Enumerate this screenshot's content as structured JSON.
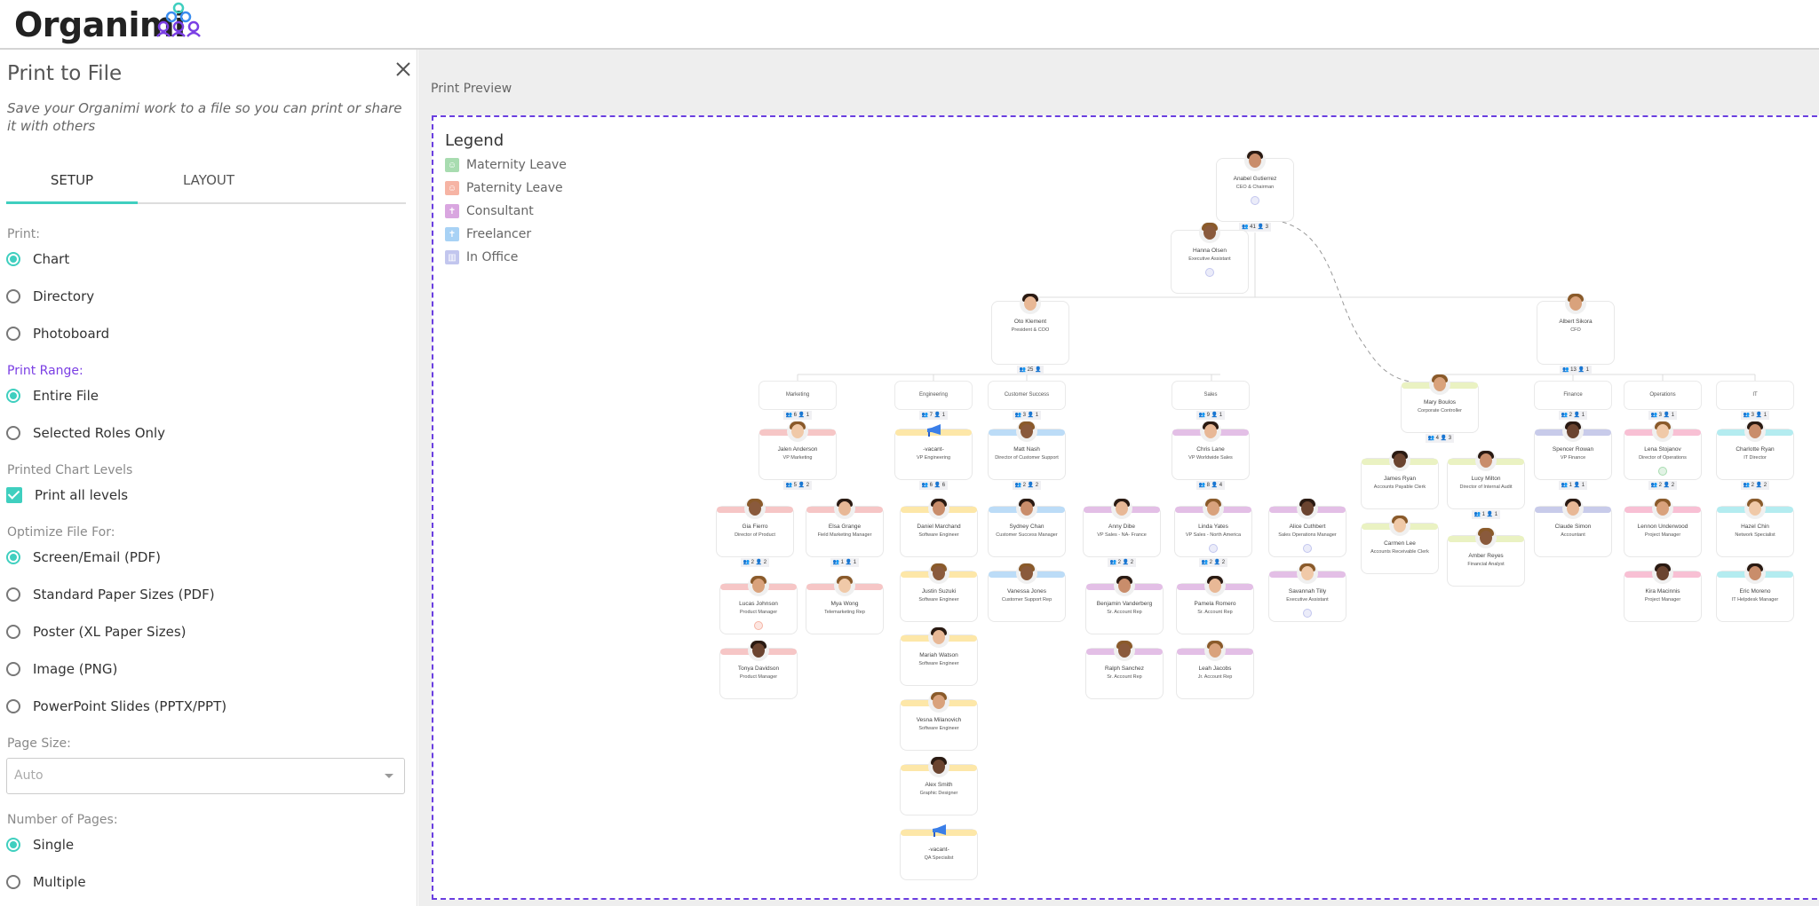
{
  "app": {
    "name": "Organimi"
  },
  "panel": {
    "title": "Print to File",
    "description": "Save your Organimi work to a file so you can print or share it with others",
    "tabs": [
      {
        "label": "SETUP",
        "active": true
      },
      {
        "label": "LAYOUT",
        "active": false
      }
    ],
    "print": {
      "label": "Print:",
      "options": [
        {
          "label": "Chart",
          "selected": true
        },
        {
          "label": "Directory",
          "selected": false
        },
        {
          "label": "Photoboard",
          "selected": false
        }
      ]
    },
    "range": {
      "label": "Print Range:",
      "options": [
        {
          "label": "Entire File",
          "selected": true
        },
        {
          "label": "Selected Roles Only",
          "selected": false
        }
      ]
    },
    "levels": {
      "label": "Printed Chart Levels",
      "checkbox_label": "Print all levels",
      "checked": true
    },
    "optimize": {
      "label": "Optimize File For:",
      "options": [
        {
          "label": "Screen/Email (PDF)",
          "selected": true
        },
        {
          "label": "Standard Paper Sizes (PDF)",
          "selected": false
        },
        {
          "label": "Poster (XL Paper Sizes)",
          "selected": false
        },
        {
          "label": "Image (PNG)",
          "selected": false
        },
        {
          "label": "PowerPoint Slides (PPTX/PPT)",
          "selected": false
        }
      ]
    },
    "page_size": {
      "label": "Page Size:",
      "value": "Auto"
    },
    "pages": {
      "label": "Number of Pages:",
      "options": [
        {
          "label": "Single",
          "selected": true
        },
        {
          "label": "Multiple",
          "selected": false
        }
      ]
    }
  },
  "preview": {
    "label": "Print Preview",
    "legend": {
      "title": "Legend",
      "items": [
        {
          "label": "Maternity Leave",
          "icon": "baby-face-icon",
          "color": "#a8dcb0"
        },
        {
          "label": "Paternity Leave",
          "icon": "baby-face-icon",
          "color": "#f6b4a4"
        },
        {
          "label": "Consultant",
          "icon": "person-icon",
          "color": "#d9a6e0"
        },
        {
          "label": "Freelancer",
          "icon": "person-icon",
          "color": "#a8d2f5"
        },
        {
          "label": "In Office",
          "icon": "building-icon",
          "color": "#c2c6ee"
        }
      ]
    }
  },
  "colors": {
    "accent": "#3fcfbf",
    "purple": "#7b3fe4",
    "marketing": "#f6c6c6",
    "engineering": "#fde7a8",
    "customer_success": "#bcdcf7",
    "sales": "#e3bfe6",
    "controller": "#eaf2c2",
    "finance": "#c8cbea",
    "operations": "#f8c0d4",
    "it": "#b4ecf0"
  },
  "org": {
    "people": [
      {
        "id": "ceo",
        "name": "Anabel Gutierrez",
        "role": "CEO & Chairman",
        "status": "in-office",
        "counts": [
          "41",
          "3"
        ]
      },
      {
        "id": "ea",
        "name": "Hanna Olsen",
        "role": "Executive Assistant",
        "status": "in-office"
      },
      {
        "id": "coo",
        "name": "Oto Klement",
        "role": "President & COO",
        "counts": [
          "25",
          ""
        ]
      },
      {
        "id": "cfo",
        "name": "Albert Sikora",
        "role": "CFO",
        "counts": [
          "13",
          "1"
        ]
      },
      {
        "id": "mkt",
        "dept": "Marketing",
        "counts": [
          "6",
          "1"
        ]
      },
      {
        "id": "eng",
        "dept": "Engineering",
        "counts": [
          "7",
          "1"
        ]
      },
      {
        "id": "cs",
        "dept": "Customer Success",
        "counts": [
          "3",
          "1"
        ]
      },
      {
        "id": "sales",
        "dept": "Sales",
        "counts": [
          "9",
          "1"
        ]
      },
      {
        "id": "fin",
        "dept": "Finance",
        "counts": [
          "2",
          "1"
        ]
      },
      {
        "id": "ops",
        "dept": "Operations",
        "counts": [
          "3",
          "1"
        ]
      },
      {
        "id": "it",
        "dept": "IT",
        "counts": [
          "3",
          "1"
        ]
      },
      {
        "id": "jalen",
        "name": "Jalen Anderson",
        "role": "VP Marketing",
        "team": "marketing",
        "counts": [
          "5",
          "2"
        ]
      },
      {
        "id": "vpeng",
        "name": "-vacant-",
        "role": "VP Engineering",
        "team": "engineering",
        "vacant": true,
        "counts": [
          "6",
          "6"
        ]
      },
      {
        "id": "matt",
        "name": "Matt Nash",
        "role": "Director of Customer Support",
        "team": "customer_success",
        "counts": [
          "2",
          "2"
        ]
      },
      {
        "id": "chris",
        "name": "Chris Lane",
        "role": "VP Worldwide Sales",
        "team": "sales",
        "counts": [
          "8",
          "4"
        ]
      },
      {
        "id": "mary",
        "name": "Mary Boulos",
        "role": "Corporate Controller",
        "team": "controller",
        "counts": [
          "4",
          "3"
        ]
      },
      {
        "id": "spencer",
        "name": "Spencer Rowan",
        "role": "VP Finance",
        "team": "finance",
        "counts": [
          "1",
          "1"
        ]
      },
      {
        "id": "lena",
        "name": "Lena Stojanov",
        "role": "Director of Operations",
        "team": "operations",
        "status": "maternity",
        "counts": [
          "2",
          "2"
        ]
      },
      {
        "id": "charlotte",
        "name": "Charlotte Ryan",
        "role": "IT Director",
        "team": "it",
        "counts": [
          "2",
          "2"
        ]
      },
      {
        "id": "gia",
        "name": "Gia Fierro",
        "role": "Director of Product",
        "team": "marketing",
        "counts": [
          "2",
          "2"
        ]
      },
      {
        "id": "elsa",
        "name": "Elsa Grange",
        "role": "Field Marketing Manager",
        "team": "marketing",
        "counts": [
          "1",
          "1"
        ]
      },
      {
        "id": "lucas",
        "name": "Lucas Johnson",
        "role": "Product Manager",
        "team": "marketing",
        "status": "paternity"
      },
      {
        "id": "tonya",
        "name": "Tonya Davidson",
        "role": "Product Manager",
        "team": "marketing"
      },
      {
        "id": "mya",
        "name": "Mya Wong",
        "role": "Telemarketing Rep",
        "team": "marketing"
      },
      {
        "id": "daniel",
        "name": "Daniel Marchand",
        "role": "Software Engineer",
        "team": "engineering"
      },
      {
        "id": "justin",
        "name": "Justin Suzuki",
        "role": "Software Engineer",
        "team": "engineering"
      },
      {
        "id": "mariah",
        "name": "Mariah Watson",
        "role": "Software Engineer",
        "team": "engineering"
      },
      {
        "id": "vesna",
        "name": "Vesna Milanovich",
        "role": "Software Engineer",
        "team": "engineering"
      },
      {
        "id": "alex",
        "name": "Alex Smith",
        "role": "Graphic Designer",
        "team": "engineering"
      },
      {
        "id": "qa",
        "name": "-vacant-",
        "role": "QA Specialist",
        "team": "engineering",
        "vacant": true
      },
      {
        "id": "sydney",
        "name": "Sydney Chan",
        "role": "Customer Success Manager",
        "team": "customer_success"
      },
      {
        "id": "vanessa",
        "name": "Vanessa Jones",
        "role": "Customer Support Rep",
        "team": "customer_success"
      },
      {
        "id": "anny",
        "name": "Anny Dibe",
        "role": "VP Sales - NA- France",
        "team": "sales",
        "counts": [
          "2",
          "2"
        ]
      },
      {
        "id": "linda",
        "name": "Linda Yates",
        "role": "VP Sales - North America",
        "team": "sales",
        "status": "in-office",
        "counts": [
          "2",
          "2"
        ]
      },
      {
        "id": "alice",
        "name": "Alice Cuthbert",
        "role": "Sales Operations Manager",
        "team": "sales",
        "status": "in-office"
      },
      {
        "id": "savannah",
        "name": "Savannah Tilly",
        "role": "Executive Assistant",
        "team": "sales",
        "status": "in-office"
      },
      {
        "id": "benjamin",
        "name": "Benjamin Vanderberg",
        "role": "Sr. Account Rep",
        "team": "sales"
      },
      {
        "id": "ralph",
        "name": "Ralph Sanchez",
        "role": "Sr. Account Rep",
        "team": "sales"
      },
      {
        "id": "pamela",
        "name": "Pamela Romero",
        "role": "Sr. Account Rep",
        "team": "sales"
      },
      {
        "id": "leah",
        "name": "Leah Jacobs",
        "role": "Jr. Account Rep",
        "team": "sales"
      },
      {
        "id": "james",
        "name": "James Ryan",
        "role": "Accounts Payable Clerk",
        "team": "controller"
      },
      {
        "id": "carmen",
        "name": "Carmen Lee",
        "role": "Accounts Receivable Clerk",
        "team": "controller"
      },
      {
        "id": "lucy",
        "name": "Lucy Milton",
        "role": "Director of Internal Audit",
        "team": "controller",
        "counts": [
          "1",
          "1"
        ]
      },
      {
        "id": "amber",
        "name": "Amber Reyes",
        "role": "Financial Analyst",
        "team": "controller"
      },
      {
        "id": "claude",
        "name": "Claude Simon",
        "role": "Accountant",
        "team": "finance"
      },
      {
        "id": "lennon",
        "name": "Lennon Underwood",
        "role": "Project Manager",
        "team": "operations"
      },
      {
        "id": "kira",
        "name": "Kira Macinnis",
        "role": "Project Manager",
        "team": "operations"
      },
      {
        "id": "hazel",
        "name": "Hazel Chin",
        "role": "Network Specialist",
        "team": "it"
      },
      {
        "id": "eric",
        "name": "Eric Moreno",
        "role": "IT Helpdesk Manager",
        "team": "it"
      }
    ]
  }
}
